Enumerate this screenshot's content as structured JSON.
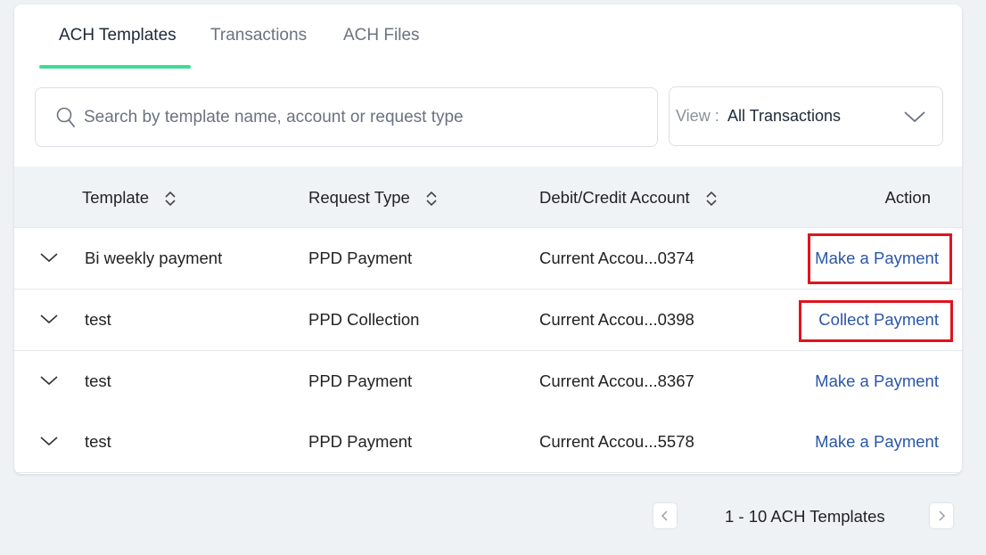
{
  "tabs": [
    {
      "label": "ACH Templates",
      "active": true
    },
    {
      "label": "Transactions",
      "active": false
    },
    {
      "label": "ACH Files",
      "active": false
    }
  ],
  "search": {
    "placeholder": "Search by template name, account or request type",
    "value": ""
  },
  "view_filter": {
    "label": "View :",
    "value": "All Transactions"
  },
  "table": {
    "columns": [
      "Template",
      "Request Type",
      "Debit/Credit Account",
      "Action"
    ],
    "rows": [
      {
        "template": "Bi weekly payment",
        "request_type": "PPD Payment",
        "account": "Current Accou...0374",
        "action": "Make a Payment",
        "highlighted": true
      },
      {
        "template": "test",
        "request_type": "PPD Collection",
        "account": "Current Accou...0398",
        "action": "Collect Payment",
        "highlighted": true
      },
      {
        "template": "test",
        "request_type": "PPD Payment",
        "account": "Current Accou...8367",
        "action": "Make a Payment",
        "highlighted": false
      },
      {
        "template": "test",
        "request_type": "PPD Payment",
        "account": "Current Accou...5578",
        "action": "Make a Payment",
        "highlighted": false
      }
    ]
  },
  "pagination": {
    "text": "1 - 10 ACH Templates"
  },
  "colors": {
    "accent": "#3ddc97",
    "link": "#2a56a8",
    "highlight": "#e0141e",
    "background": "#eff2f5"
  }
}
